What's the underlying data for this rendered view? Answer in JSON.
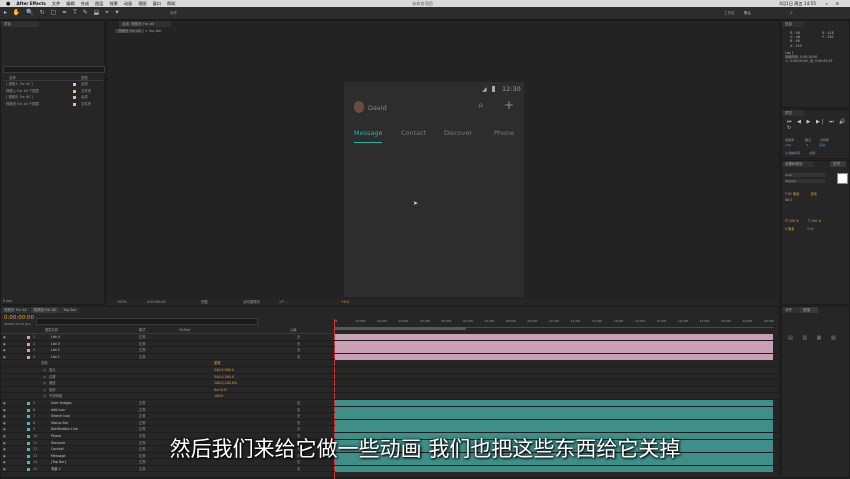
{
  "menubar": {
    "apple": "",
    "app": "After Effects",
    "items": [
      "文件",
      "编辑",
      "合成",
      "图层",
      "效果",
      "动画",
      "视图",
      "窗口",
      "帮助"
    ],
    "window_title": "未命名项目",
    "clock": "4月1日 周五 14:55"
  },
  "toolbar": {
    "snap_label": "对齐",
    "workspace": "工作区",
    "default": "默认"
  },
  "project": {
    "tab": "项目",
    "search_placeholder": "",
    "col_name": "名称",
    "col_type": "类型",
    "items": [
      {
        "name": "[ 视频入 For All ]",
        "type": "合成",
        "color": "#d9b8d6"
      },
      {
        "name": "视频入 For All 个图层",
        "type": "文件夹",
        "color": "#e3c36b"
      },
      {
        "name": "[ 视频页 For All ]",
        "type": "合成",
        "color": "#d9b8d6"
      },
      {
        "name": "视频页 For All 个图层",
        "type": "文件夹",
        "color": "#e3c36b"
      }
    ],
    "bpc": "8 bpc"
  },
  "composition": {
    "tab": "合成: 视频页 For All",
    "breadcrumbs": [
      "视频页 For All",
      "Top Bar"
    ],
    "zoom": "100%",
    "timecode": "0:00:00:00",
    "quality": "完整",
    "camera": "活动摄像机",
    "view_count": "1个...",
    "offset": "+0.0"
  },
  "phone": {
    "time": "12:30",
    "user": "David",
    "tabs": [
      "Message",
      "Contact",
      "Discover",
      "Phone"
    ],
    "active_color": "#29b3a3"
  },
  "info": {
    "r": "R : 56",
    "g": "G : 46",
    "b": "B : 46",
    "a": "A : 255",
    "x": "X : 418",
    "y": "Y : 328",
    "list_title": "List 1",
    "dur1": "持续时间: 0:00:10:00",
    "in_out": "入: 0:00:00:00, 出: 0:00:09:29"
  },
  "preview": {
    "title": "预览",
    "frame_label": "帧速率",
    "skip": "跳过",
    "resolution": "分辨率",
    "fps": "(30)",
    "res_val": "自动",
    "skip_val": "0",
    "from_current": "从当前时间",
    "full_screen": "全屏"
  },
  "effects_panel": {
    "title": "效果和预设",
    "search": ""
  },
  "character": {
    "title": "字符",
    "font": "Arial",
    "style": "Regular",
    "size": "61 像素",
    "auto": "自动",
    "tracking": "0",
    "vscale": "100 %",
    "hscale": "100 %",
    "baseline": "0 像素",
    "tsume": "0 %"
  },
  "paragraph": {
    "title": "段落",
    "align": "对齐"
  },
  "timeline": {
    "tabs": [
      "视频页 For All",
      "视频页 For All",
      "Top Bar"
    ],
    "timecode": "0:00:00:00",
    "fps_note": "00000 (30.00 fps)",
    "col_name": "图层名称",
    "col_mode": "模式",
    "col_trkmat": "TrkMat",
    "col_parent": "父级",
    "mode_val": "正常",
    "parent_val": "无",
    "ruler": [
      "0f",
      "01:00f",
      "02:00f",
      "03:00f",
      "04:00f",
      "05:00f",
      "06:00f",
      "07:00f",
      "08:00f",
      "09:00f",
      "10:00f",
      "11:00f",
      "12:00f",
      "13:00f",
      "14:00f",
      "15:00f",
      "16:00f",
      "17:00f",
      "18:00f",
      "19:00f",
      "20:00f"
    ],
    "layers_top": [
      {
        "num": "1",
        "name": "List 4",
        "color": "#d99bbf"
      },
      {
        "num": "2",
        "name": "List 3",
        "color": "#d99bbf"
      },
      {
        "num": "3",
        "name": "List 2",
        "color": "#d99bbf"
      },
      {
        "num": "4",
        "name": "List 1",
        "color": "#d99bbf"
      }
    ],
    "transform": {
      "label": "变换",
      "reset": "重置",
      "props": [
        {
          "name": "锚点",
          "value": "540.0,360.0"
        },
        {
          "name": "位置",
          "value": "540.0,360.0"
        },
        {
          "name": "缩放",
          "value": "100.0,100.0%"
        },
        {
          "name": "旋转",
          "value": "0x+0.0°"
        },
        {
          "name": "不透明度",
          "value": "100%"
        }
      ]
    },
    "layers_bottom": [
      {
        "num": "5",
        "name": "User Images",
        "color": "#4fb8b0"
      },
      {
        "num": "6",
        "name": "Add Icon",
        "color": "#4fb8b0"
      },
      {
        "num": "7",
        "name": "Search Icon",
        "color": "#4fb8b0"
      },
      {
        "num": "8",
        "name": "Status Bar",
        "color": "#4fb8b0"
      },
      {
        "num": "9",
        "name": "Notification Line",
        "color": "#4fb8b0"
      },
      {
        "num": "10",
        "name": "Phone",
        "color": "#4fb8b0"
      },
      {
        "num": "11",
        "name": "Discover",
        "color": "#4fb8b0"
      },
      {
        "num": "12",
        "name": "Contact",
        "color": "#4fb8b0"
      },
      {
        "num": "13",
        "name": "Message",
        "color": "#4fb8b0"
      },
      {
        "num": "14",
        "name": "[Top Bar]",
        "color": "#4fb8b0"
      },
      {
        "num": "15",
        "name": "背景 2",
        "color": "#4fb8b0"
      }
    ]
  },
  "right_bottom": {
    "tabs": [
      "对齐",
      "段落"
    ],
    "title": "对齐"
  },
  "subtitle": "然后我们来给它做一些动画 我们也把这些东西给它关掉"
}
